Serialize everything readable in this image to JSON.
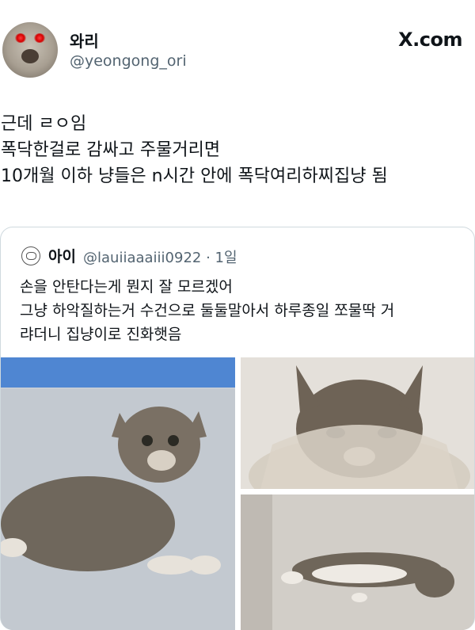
{
  "author": {
    "name": "와리",
    "handle": "@yeongong_ori"
  },
  "brand": "X.com",
  "tweet_lines": [
    "근데 ㄹㅇ임",
    "폭닥한걸로 감싸고 주물거리면",
    "10개월 이하 냥들은 n시간 안에 폭닥여리하찌집냥 됨"
  ],
  "quoted": {
    "name": "아이",
    "handle_time": "@lauiiaaaiii0922 · 1일",
    "lines": [
      "손을 안탄다는게 뭔지 잘 모르겠어",
      "그냥 하악질하는거 수건으로 둘둘말아서 하루종일 쪼물딱 거",
      "랴더니 집냥이로 진화햇음"
    ]
  },
  "icons": {
    "avatar": "user-avatar",
    "quoted_avatar": "quoted-user-avatar"
  },
  "colors": {
    "text": "#0f1419",
    "secondary_text": "#536471",
    "border": "#cfd9de"
  }
}
